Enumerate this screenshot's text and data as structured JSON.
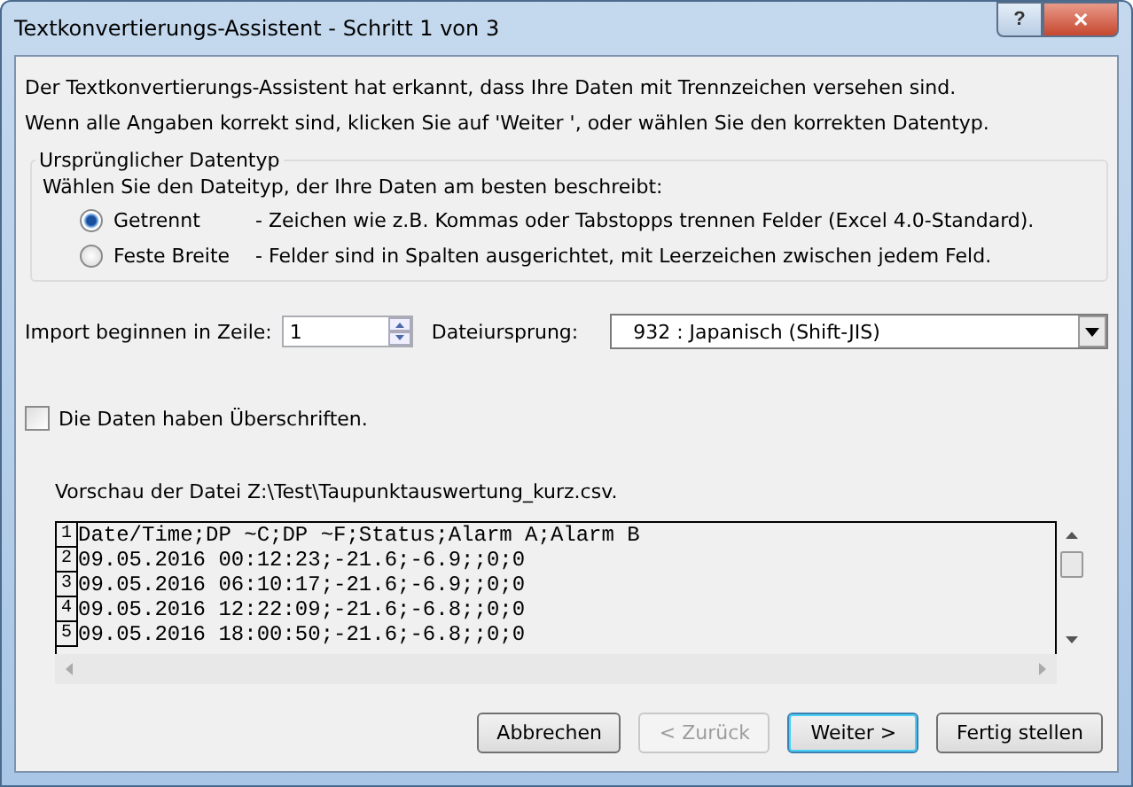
{
  "window": {
    "title": "Textkonvertierungs-Assistent - Schritt 1 von 3",
    "help_button": "?",
    "close_button": "✕"
  },
  "intro": [
    "Der Textkonvertierungs-Assistent hat erkannt, dass Ihre Daten mit Trennzeichen versehen sind.",
    "Wenn alle Angaben korrekt sind, klicken Sie auf 'Weiter ', oder wählen Sie den korrekten Datentyp."
  ],
  "data_type_group": {
    "title": "Ursprünglicher Datentyp",
    "prompt": "Wählen Sie den Dateityp, der Ihre Daten am besten beschreibt:",
    "options": [
      {
        "label": "Getrennt",
        "description": "- Zeichen wie z.B. Kommas oder Tabstopps trennen Felder (Excel 4.0-Standard).",
        "selected": true
      },
      {
        "label": "Feste Breite",
        "description": "- Felder sind in Spalten ausgerichtet, mit Leerzeichen zwischen jedem Feld.",
        "selected": false
      }
    ]
  },
  "start_row": {
    "label": "Import beginnen in Zeile:",
    "value": "1"
  },
  "file_origin": {
    "label": "Dateiursprung:",
    "value": "932 : Japanisch (Shift-JIS)"
  },
  "headers_checkbox": {
    "label": "Die Daten haben Überschriften.",
    "checked": false
  },
  "preview": {
    "label": "Vorschau der Datei Z:\\Test\\Taupunktauswertung_kurz.csv.",
    "lines": [
      {
        "number": "1",
        "text": "Date/Time;DP ~C;DP ~F;Status;Alarm A;Alarm B"
      },
      {
        "number": "2",
        "text": "09.05.2016 00:12:23;-21.6;-6.9;;0;0"
      },
      {
        "number": "3",
        "text": "09.05.2016 06:10:17;-21.6;-6.9;;0;0"
      },
      {
        "number": "4",
        "text": "09.05.2016 12:22:09;-21.6;-6.8;;0;0"
      },
      {
        "number": "5",
        "text": "09.05.2016 18:00:50;-21.6;-6.8;;0;0"
      }
    ]
  },
  "buttons": [
    {
      "label": "Abbrechen",
      "disabled": false,
      "default": false
    },
    {
      "label": "< Zurück",
      "disabled": true,
      "default": false
    },
    {
      "label": "Weiter >",
      "disabled": false,
      "default": true
    },
    {
      "label": "Fertig stellen",
      "disabled": false,
      "default": false
    }
  ]
}
